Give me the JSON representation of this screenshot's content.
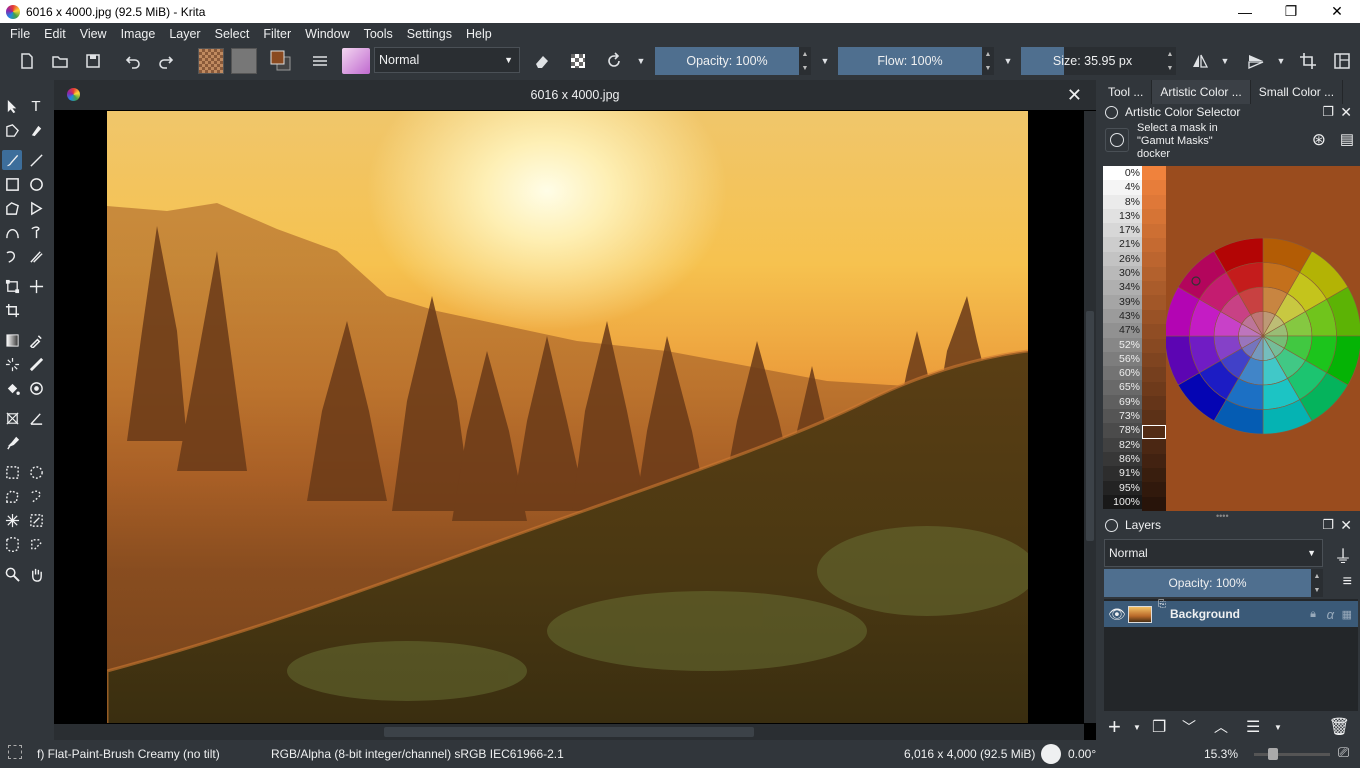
{
  "window": {
    "title": "6016 x 4000.jpg (92.5 MiB) - Krita",
    "min": "—",
    "max": "❐",
    "close": "✕"
  },
  "menu": [
    "File",
    "Edit",
    "View",
    "Image",
    "Layer",
    "Select",
    "Filter",
    "Window",
    "Tools",
    "Settings",
    "Help"
  ],
  "toolbar": {
    "blend_mode": "Normal",
    "opacity": "Opacity: 100%",
    "flow": "Flow: 100%",
    "size": "Size: 35.95 px"
  },
  "document": {
    "tab_title": "6016 x 4000.jpg",
    "close": "✕"
  },
  "dock": {
    "tabs": [
      "Tool ...",
      "Artistic Color ...",
      "Small Color ..."
    ],
    "color_selector_title": "Artistic Color Selector",
    "mask_hint": "Select a mask in \"Gamut Masks\" docker",
    "value_labels": [
      "0%",
      "4%",
      "8%",
      "13%",
      "17%",
      "21%",
      "26%",
      "30%",
      "34%",
      "39%",
      "43%",
      "47%",
      "52%",
      "56%",
      "60%",
      "65%",
      "69%",
      "73%",
      "78%",
      "82%",
      "86%",
      "91%",
      "95%",
      "100%"
    ],
    "layers_title": "Layers",
    "layer_blend": "Normal",
    "layer_opacity": "Opacity:  100%",
    "layers": [
      {
        "name": "Background"
      }
    ]
  },
  "status": {
    "brush": "f) Flat-Paint-Brush Creamy (no tilt)",
    "color_model": "RGB/Alpha (8-bit integer/channel)  sRGB IEC61966-2.1",
    "image_size": "6,016 x 4,000 (92.5 MiB)",
    "rotation": "0.00°",
    "zoom": "15.3%"
  },
  "colors": {
    "accent": "#3d6e9b",
    "slider": "#4f6f8f",
    "bg": "#31363b"
  }
}
